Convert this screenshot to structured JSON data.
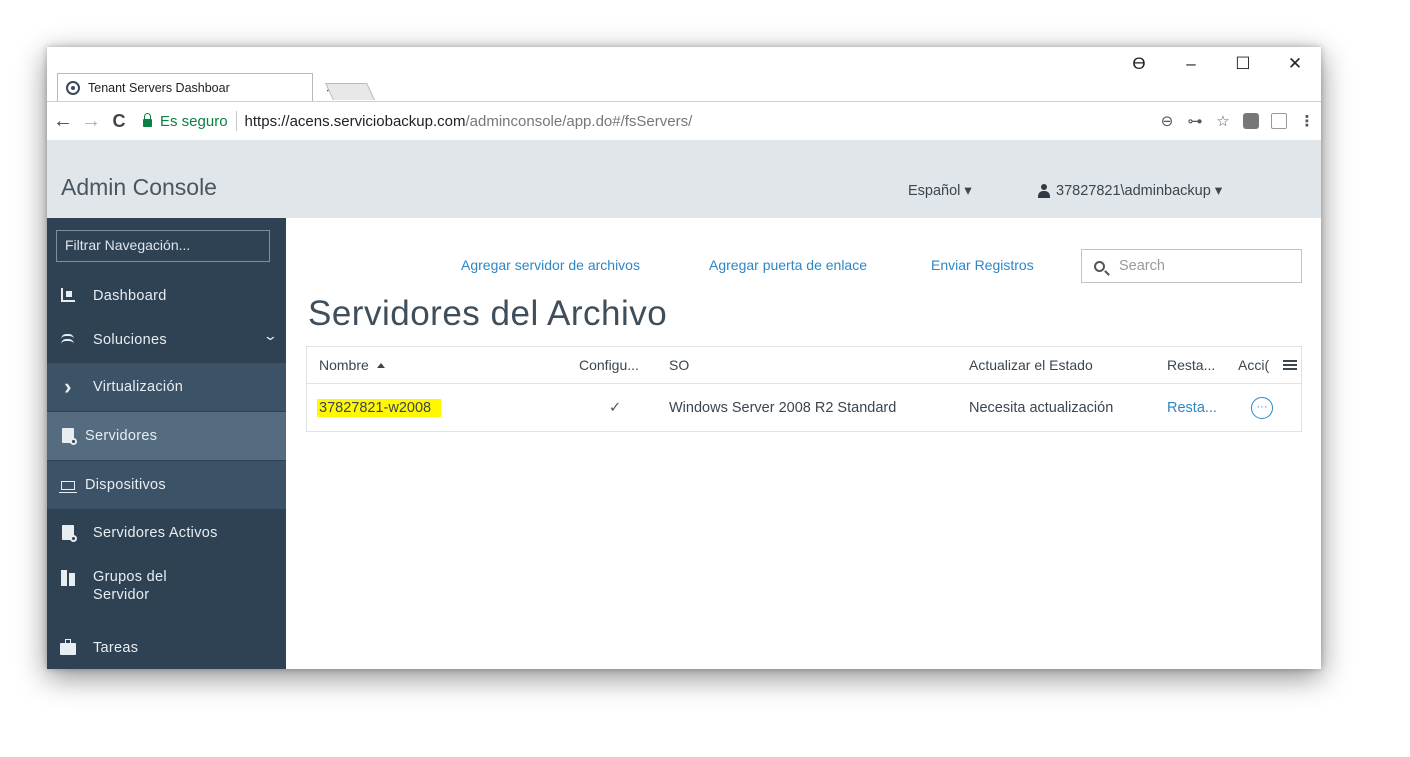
{
  "browser": {
    "tab_title": "Tenant Servers Dashboar",
    "tab_close": "×",
    "window_controls": {
      "account": "ϴ",
      "minimize": "–",
      "maximize": "☐",
      "close": "✕"
    },
    "nav": {
      "back": "←",
      "forward": "→",
      "reload": "C"
    },
    "security_label": "Es seguro",
    "url_scheme_host": "https://acens.serviciobackup.com",
    "url_path": "/adminconsole/app.do#/fsServers/",
    "toolbar_icons": {
      "zoom": "⊖",
      "key": "⊶",
      "star": "☆",
      "menu": "⋮"
    }
  },
  "header": {
    "app_title": "Admin Console",
    "language": "Español ▾",
    "user": "37827821\\adminbackup ▾"
  },
  "sidebar": {
    "filter_placeholder": "Filtrar Navegación...",
    "items": [
      {
        "label": "Dashboard",
        "icon": "dashboard-icon"
      },
      {
        "label": "Soluciones",
        "icon": "layers-icon",
        "chevron": "⌄"
      },
      {
        "label": "Virtualización",
        "icon": "chevron-right-icon",
        "glyph": "›"
      },
      {
        "label": "Servidores",
        "icon": "server-icon",
        "active": true
      },
      {
        "label": "Dispositivos",
        "icon": "laptop-icon"
      },
      {
        "label": "Servidores Activos",
        "icon": "server-icon"
      },
      {
        "label": "Grupos del Servidor",
        "icon": "server-group-icon"
      },
      {
        "label": "Tareas",
        "icon": "briefcase-icon"
      }
    ]
  },
  "main": {
    "actions": {
      "add_file_server": "Agregar servidor de archivos",
      "add_gateway": "Agregar puerta de enlace",
      "send_logs": "Enviar Registros"
    },
    "search_placeholder": "Search",
    "title": "Servidores del Archivo",
    "table": {
      "columns": [
        "Nombre",
        "Configu...",
        "SO",
        "Actualizar el Estado",
        "Resta...",
        "Acci("
      ],
      "rows": [
        {
          "name": "37827821-w2008",
          "configured": "✓",
          "os": "Windows Server 2008 R2 Standard",
          "update_status": "Necesita actualización",
          "restore": "Resta...",
          "actions": "···"
        }
      ]
    }
  }
}
